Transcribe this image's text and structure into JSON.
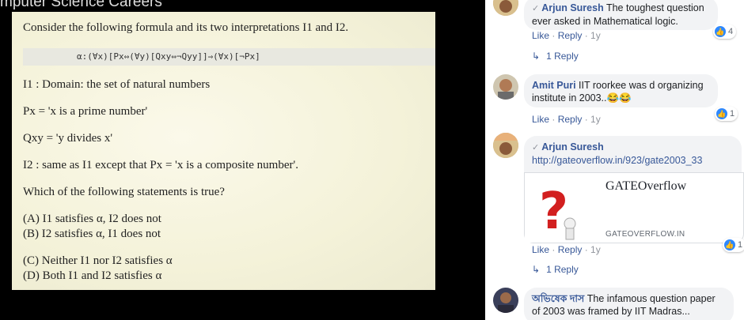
{
  "page_heading_partial": "mputer Science Careers",
  "question": {
    "intro": "Consider the following formula and its two interpretations I1 and I2.",
    "formula": "α:(∀x)[Px⇔(∀y)[Qxy⇔¬Qyy]]⇒(∀x)[¬Px]",
    "i1_domain": "I1 : Domain: the set of natural numbers",
    "px_def": "Px = 'x is a prime number'",
    "qxy_def": "Qxy = 'y divides x'",
    "i2_def": "I2 : same as I1 except that Px = 'x is a composite number'.",
    "prompt": "Which of the following statements is true?",
    "options": [
      "(A) I1 satisfies α, I2 does not",
      "(B) I2 satisfies α, I1 does not",
      "(C) Neither I1 nor I2 satisfies α",
      "(D) Both I1 and I2 satisfies α"
    ]
  },
  "comments": [
    {
      "author": "Arjun Suresh",
      "text": "The toughest question ever asked in Mathematical logic.",
      "like_label": "Like",
      "reply_label": "Reply",
      "age": "1y",
      "reactions": "4",
      "replies": "1 Reply"
    },
    {
      "author": "Amit Puri",
      "text": "IIT roorkee was d organizing institute in 2003..😂😂",
      "like_label": "Like",
      "reply_label": "Reply",
      "age": "1y",
      "reactions": "1"
    },
    {
      "author": "Arjun Suresh",
      "link_url": "http://gateoverflow.in/923/gate2003_33",
      "link_title": "GATEOverflow",
      "link_domain": "GATEOVERFLOW.IN",
      "like_label": "Like",
      "reply_label": "Reply",
      "age": "1y",
      "reactions": "1",
      "replies": "1 Reply"
    },
    {
      "author": "অভিষেক দাস",
      "text": "The infamous question paper of 2003 was framed by IIT Madras..."
    }
  ],
  "colors": {
    "link": "#385898",
    "bubble": "#f2f3f5",
    "like": "#2d88ff"
  }
}
